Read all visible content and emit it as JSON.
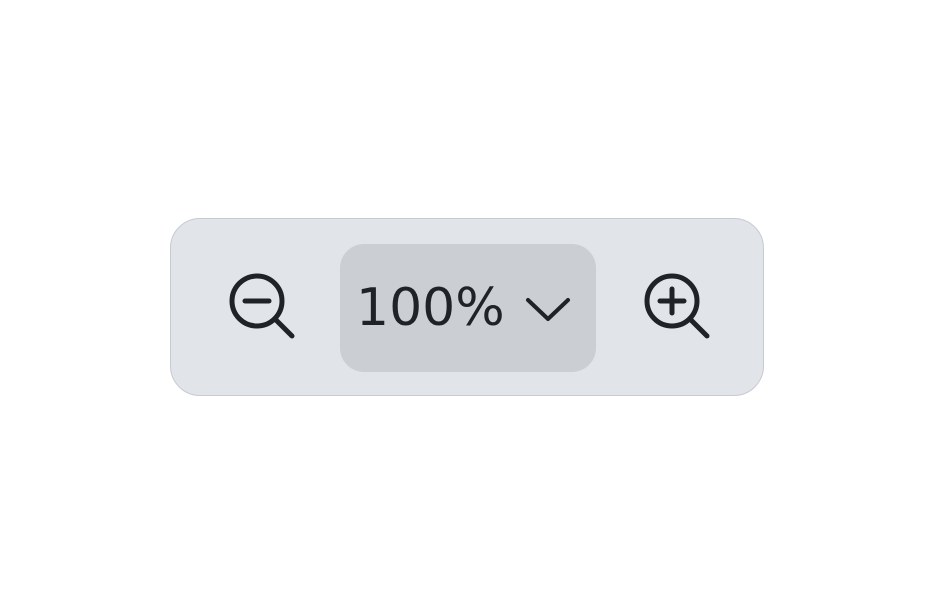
{
  "zoom_control": {
    "zoom_level": "100%",
    "zoom_out_icon": "zoom-out-icon",
    "zoom_in_icon": "zoom-in-icon",
    "dropdown_icon": "chevron-down-icon"
  },
  "colors": {
    "bar_background": "#e1e4e8",
    "bar_border": "#c7cacf",
    "select_background": "#cbced2",
    "icon_color": "#1f2328"
  }
}
